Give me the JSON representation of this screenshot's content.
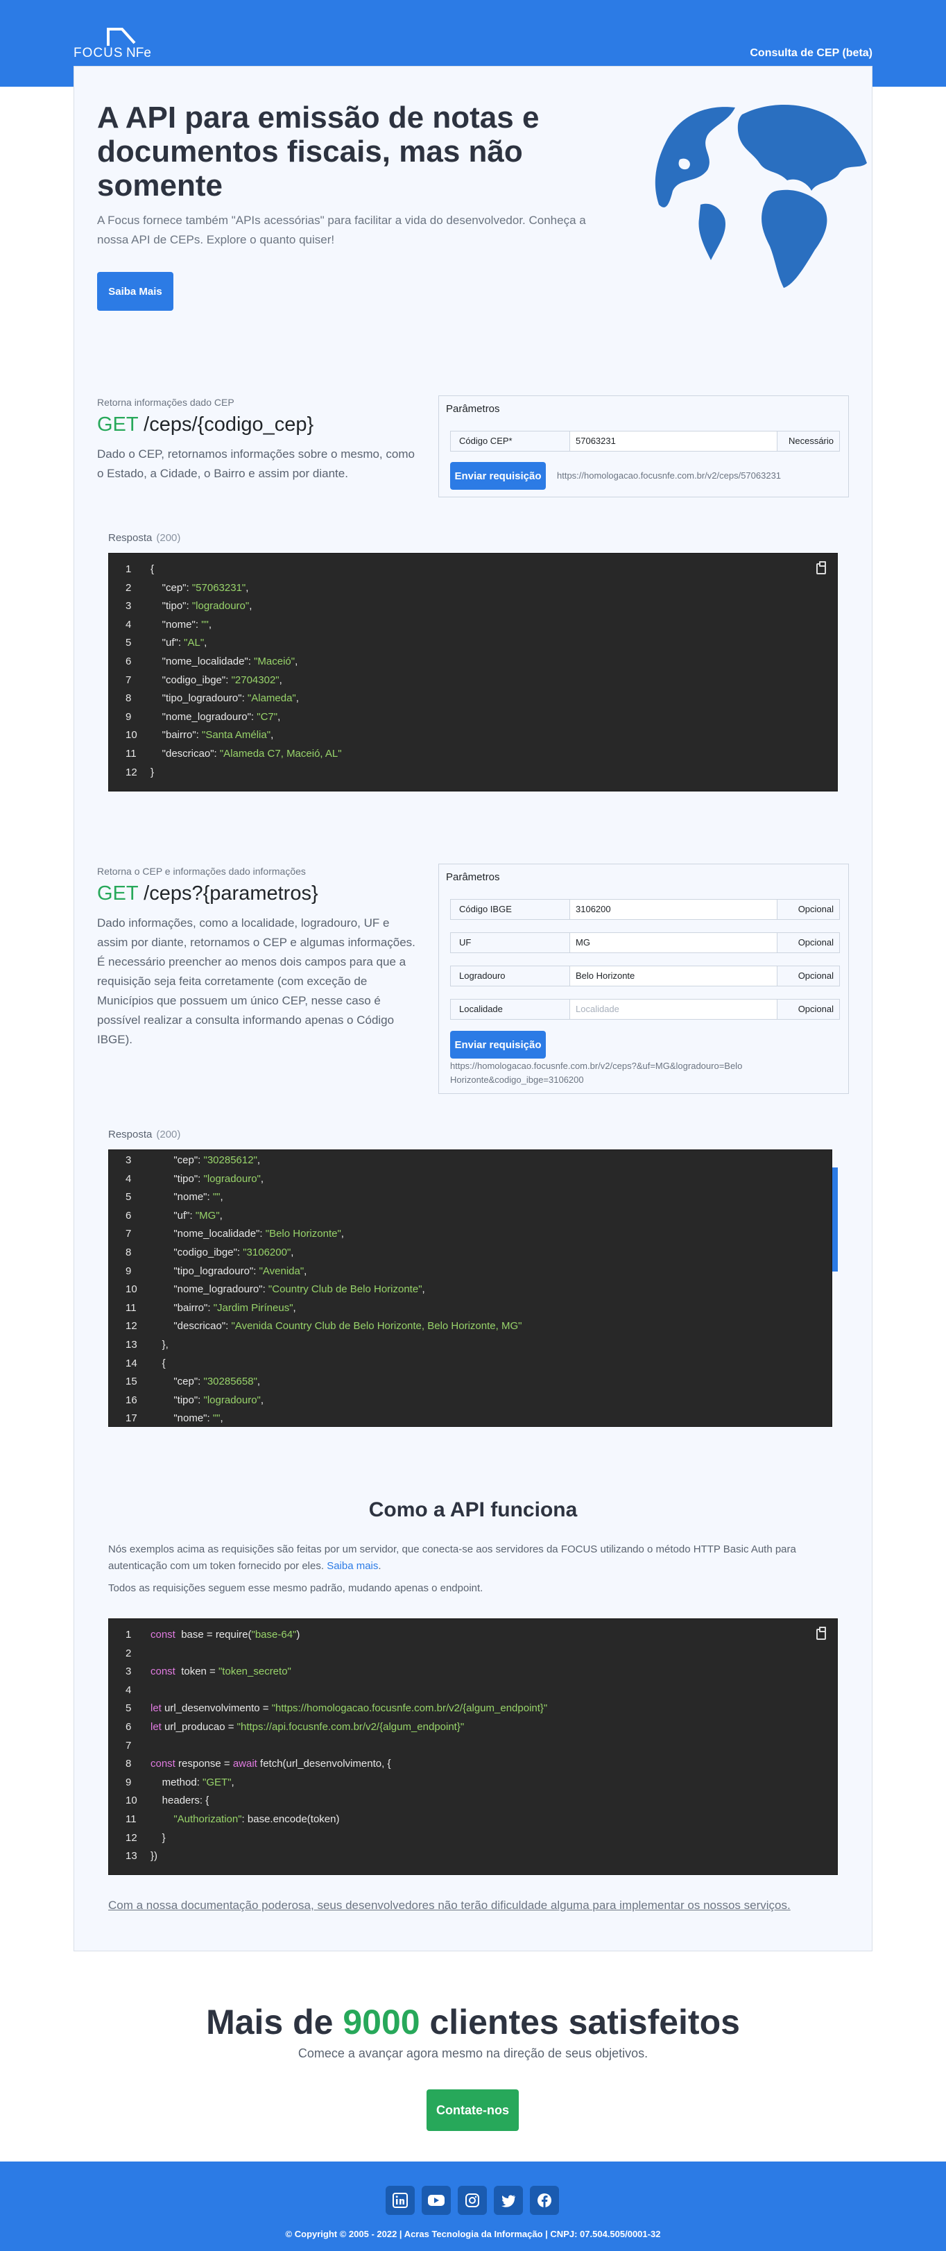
{
  "brand": {
    "logo_left": "FOCUS",
    "logo_right": "NFe"
  },
  "nav": {
    "link": "Consulta de CEP (beta)"
  },
  "hero": {
    "title": "A API para emissão de notas e documentos fiscais, mas não somente",
    "subtitle": "A Focus fornece também \"APIs acessórias\" para facilitar a vida do desenvolvedor. Conheça a nossa API de CEPs. Explore o quanto quiser!",
    "button": "Saiba Mais"
  },
  "cep": {
    "kicker": "Retorna informações dado CEP",
    "method": "GET",
    "path": "/ceps/{codigo_cep}",
    "description": "Dado o CEP, retornamos informações sobre o mesmo, como o Estado, a Cidade, o Bairro e assim por diante.",
    "params_title": "Parâmetros",
    "field_label": "Código CEP*",
    "field_value": "57063231",
    "field_req": "Necessário",
    "send": "Enviar requisição",
    "url": "https://homologacao.focusnfe.com.br/v2/ceps/57063231",
    "response_label": "Resposta",
    "response_code": "(200)",
    "lines": [
      {
        "n": "1",
        "t": "{"
      },
      {
        "n": "2",
        "k": "    \"cep\": ",
        "v": "\"57063231\"",
        "e": ","
      },
      {
        "n": "3",
        "k": "    \"tipo\": ",
        "v": "\"logradouro\"",
        "e": ","
      },
      {
        "n": "4",
        "k": "    \"nome\": ",
        "v": "\"\"",
        "e": ","
      },
      {
        "n": "5",
        "k": "    \"uf\": ",
        "v": "\"AL\"",
        "e": ","
      },
      {
        "n": "6",
        "k": "    \"nome_localidade\": ",
        "v": "\"Maceió\"",
        "e": ","
      },
      {
        "n": "7",
        "k": "    \"codigo_ibge\": ",
        "v": "\"2704302\"",
        "e": ","
      },
      {
        "n": "8",
        "k": "    \"tipo_logradouro\": ",
        "v": "\"Alameda\"",
        "e": ","
      },
      {
        "n": "9",
        "k": "    \"nome_logradouro\": ",
        "v": "\"C7\"",
        "e": ","
      },
      {
        "n": "10",
        "k": "    \"bairro\": ",
        "v": "\"Santa Amélia\"",
        "e": ","
      },
      {
        "n": "11",
        "k": "    \"descricao\": ",
        "v": "\"Alameda C7, Maceió, AL\"",
        "e": ""
      },
      {
        "n": "12",
        "t": "}"
      }
    ]
  },
  "ceps": {
    "kicker": "Retorna o CEP e informações dado informações",
    "method": "GET",
    "path": "/ceps?{parametros}",
    "description": "Dado informações, como a localidade, logradouro, UF e assim por diante, retornamos o CEP e algumas informações. É necessário preencher ao menos dois campos para que a requisição seja feita corretamente (com exceção de Municípios que possuem um único CEP, nesse caso é possível realizar a consulta informando apenas o Código IBGE).",
    "params_title": "Parâmetros",
    "fields": [
      {
        "label": "Código IBGE",
        "value": "3106200",
        "placeholder": "",
        "req": "Opcional"
      },
      {
        "label": "UF",
        "value": "MG",
        "placeholder": "",
        "req": "Opcional"
      },
      {
        "label": "Logradouro",
        "value": "Belo Horizonte",
        "placeholder": "",
        "req": "Opcional"
      },
      {
        "label": "Localidade",
        "value": "",
        "placeholder": "Localidade",
        "req": "Opcional"
      }
    ],
    "send": "Enviar requisição",
    "url": "https://homologacao.focusnfe.com.br/v2/ceps?&uf=MG&logradouro=Belo Horizonte&codigo_ibge=3106200",
    "response_label": "Resposta",
    "response_code": "(200)",
    "lines": [
      {
        "n": "3",
        "k": "        \"cep\": ",
        "v": "\"30285612\"",
        "e": ","
      },
      {
        "n": "4",
        "k": "        \"tipo\": ",
        "v": "\"logradouro\"",
        "e": ","
      },
      {
        "n": "5",
        "k": "        \"nome\": ",
        "v": "\"\"",
        "e": ","
      },
      {
        "n": "6",
        "k": "        \"uf\": ",
        "v": "\"MG\"",
        "e": ","
      },
      {
        "n": "7",
        "k": "        \"nome_localidade\": ",
        "v": "\"Belo Horizonte\"",
        "e": ","
      },
      {
        "n": "8",
        "k": "        \"codigo_ibge\": ",
        "v": "\"3106200\"",
        "e": ","
      },
      {
        "n": "9",
        "k": "        \"tipo_logradouro\": ",
        "v": "\"Avenida\"",
        "e": ","
      },
      {
        "n": "10",
        "k": "        \"nome_logradouro\": ",
        "v": "\"Country Club de Belo Horizonte\"",
        "e": ","
      },
      {
        "n": "11",
        "k": "        \"bairro\": ",
        "v": "\"Jardim Piríneus\"",
        "e": ","
      },
      {
        "n": "12",
        "k": "        \"descricao\": ",
        "v": "\"Avenida Country Club de Belo Horizonte, Belo Horizonte, MG\"",
        "e": ""
      },
      {
        "n": "13",
        "t": "    },"
      },
      {
        "n": "14",
        "t": "    {"
      },
      {
        "n": "15",
        "k": "        \"cep\": ",
        "v": "\"30285658\"",
        "e": ","
      },
      {
        "n": "16",
        "k": "        \"tipo\": ",
        "v": "\"logradouro\"",
        "e": ","
      },
      {
        "n": "17",
        "k": "        \"nome\": ",
        "v": "\"\"",
        "e": ","
      }
    ]
  },
  "how": {
    "title": "Como a API funciona",
    "p1": "Nós exemplos acima as requisições são feitas por um servidor, que conecta-se aos servidores da FOCUS utilizando o método HTTP Basic Auth para autenticação com um token fornecido por eles.",
    "p1_link": "Saiba mais",
    "p2": "Todos as requisições seguem esse mesmo padrão, mudando apenas o endpoint.",
    "code": [
      {
        "n": "1",
        "parts": [
          [
            "kw",
            "const"
          ],
          [
            "",
            "  base = require("
          ],
          [
            "str",
            "\"base-64\""
          ],
          [
            "",
            ")"
          ]
        ]
      },
      {
        "n": "2",
        "parts": []
      },
      {
        "n": "3",
        "parts": [
          [
            "kw",
            "const"
          ],
          [
            "",
            "  token = "
          ],
          [
            "str",
            "\"token_secreto\""
          ]
        ]
      },
      {
        "n": "4",
        "parts": []
      },
      {
        "n": "5",
        "parts": [
          [
            "kw",
            "let"
          ],
          [
            "",
            " url_desenvolvimento = "
          ],
          [
            "str",
            "\"https://homologacao.focusnfe.com.br/v2/{algum_endpoint}\""
          ]
        ]
      },
      {
        "n": "6",
        "parts": [
          [
            "kw",
            "let"
          ],
          [
            "",
            " url_producao = "
          ],
          [
            "str",
            "\"https://api.focusnfe.com.br/v2/{algum_endpoint}\""
          ]
        ]
      },
      {
        "n": "7",
        "parts": []
      },
      {
        "n": "8",
        "parts": [
          [
            "kw",
            "const"
          ],
          [
            "",
            " response = "
          ],
          [
            "kw",
            "await"
          ],
          [
            "",
            " fetch(url_desenvolvimento, {"
          ]
        ]
      },
      {
        "n": "9",
        "parts": [
          [
            "",
            "    method: "
          ],
          [
            "str",
            "\"GET\""
          ],
          [
            "",
            ","
          ]
        ]
      },
      {
        "n": "10",
        "parts": [
          [
            "",
            "    headers: {"
          ]
        ]
      },
      {
        "n": "11",
        "parts": [
          [
            "",
            "        "
          ],
          [
            "str",
            "\"Authorization\""
          ],
          [
            "",
            ": base.encode(token)"
          ]
        ]
      },
      {
        "n": "12",
        "parts": [
          [
            "",
            "    }"
          ]
        ]
      },
      {
        "n": "13",
        "parts": [
          [
            "",
            "})"
          ]
        ]
      }
    ],
    "doc_link": "Com a nossa documentação poderosa, seus desenvolvedores não terão dificuldade alguma para implementar os nossos serviços."
  },
  "clients": {
    "prefix": "Mais de ",
    "number": "9000",
    "suffix": " clientes satisfeitos",
    "subtitle": "Comece a avançar agora mesmo na direção de seus objetivos.",
    "button": "Contate-nos"
  },
  "footer": {
    "social": [
      "linkedin-icon",
      "youtube-icon",
      "instagram-icon",
      "twitter-icon",
      "facebook-icon"
    ],
    "copyright": "© Copyright © 2005 - 2022 | Acras Tecnologia da Informação | CNPJ: 07.504.505/0001-32"
  },
  "colors": {
    "primary": "#2c7be5",
    "green": "#27a85a",
    "code_bg": "#282828"
  }
}
